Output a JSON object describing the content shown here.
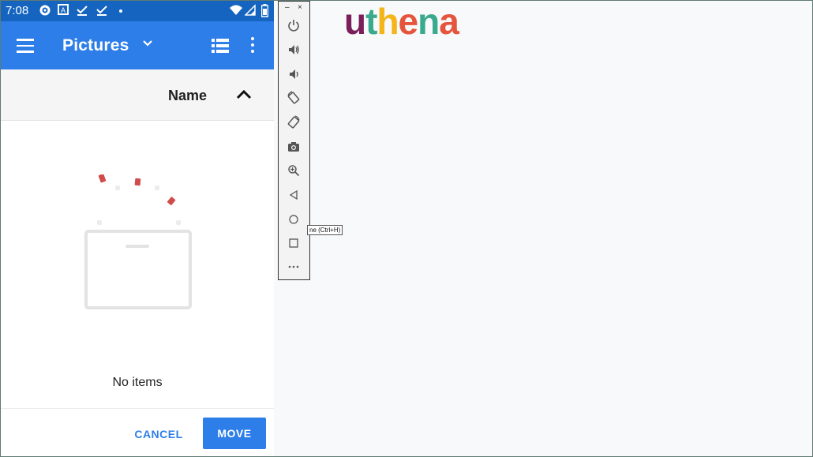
{
  "status_bar": {
    "time": "7:08",
    "icons": [
      "settings-icon",
      "a-badge-icon",
      "check-icon",
      "check-icon",
      "dot-icon",
      "wifi-icon",
      "signal-icon",
      "battery-icon"
    ]
  },
  "app_bar": {
    "title": "Pictures",
    "color": "#2d7ee8",
    "icons": [
      "hamburger-menu-icon",
      "chevron-down-icon",
      "list-view-icon",
      "more-vert-icon"
    ]
  },
  "sort": {
    "label": "Name",
    "direction_icon": "chevron-up-icon"
  },
  "empty_state": {
    "message": "No items"
  },
  "footer": {
    "cancel_label": "CANCEL",
    "move_label": "MOVE"
  },
  "emulator_toolbar": {
    "minimize": "–",
    "close": "×",
    "buttons": [
      "power-icon",
      "volume-up-icon",
      "volume-down-icon",
      "rotate-left-icon",
      "rotate-right-icon",
      "camera-icon",
      "zoom-icon",
      "back-icon",
      "home-icon",
      "overview-icon",
      "more-icon"
    ],
    "tooltip": "ne (Ctrl+H)"
  },
  "logo": {
    "letters": [
      "u",
      "t",
      "h",
      "e",
      "n",
      "a"
    ],
    "colors": [
      "#7a1f5c",
      "#3aaa8f",
      "#f4b41a",
      "#e5553d",
      "#3aaa8f",
      "#e5553d"
    ]
  }
}
